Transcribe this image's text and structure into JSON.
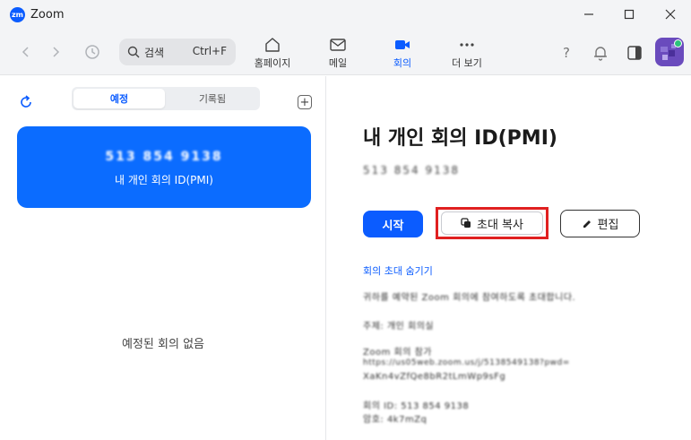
{
  "window": {
    "logo_text": "zm",
    "title": "Zoom",
    "minimize": "—",
    "maximize": "☐",
    "close": "✕"
  },
  "toolbar": {
    "search_label": "검색",
    "search_shortcut": "Ctrl+F",
    "nav": [
      {
        "label": "홈페이지",
        "icon": "home-icon"
      },
      {
        "label": "메일",
        "icon": "mail-icon"
      },
      {
        "label": "회의",
        "icon": "video-camera-icon",
        "active": true
      },
      {
        "label": "더 보기",
        "icon": "more-dots-icon"
      }
    ],
    "help_glyph": "?",
    "accent": "#0b5cff"
  },
  "left": {
    "tabs": [
      {
        "label": "예정",
        "active": true
      },
      {
        "label": "기록됨",
        "active": false
      }
    ],
    "add_glyph": "+",
    "pmi_number": "513 854 9138",
    "pmi_label": "내 개인 회의 ID(PMI)",
    "empty": "예정된 회의 없음"
  },
  "right": {
    "title": "내 개인 회의 ID(PMI)",
    "meeting_id": "513 854 9138",
    "start_label": "시작",
    "copy_label": "초대 복사",
    "edit_label": "편집",
    "hide_invite_label": "회의 초대 숨기기",
    "invite_lines": [
      "귀하를 예약된 Zoom 회의에 참여하도록 초대합니다.",
      "주제: 개인 회의실",
      "Zoom 회의 참가",
      "https://us05web.zoom.us/j/5138549138?pwd=",
      "XaKn4vZfQe8bR2tLmWp9sFg",
      "회의 ID: 513 854 9138",
      "암호: 4k7mZq"
    ]
  }
}
